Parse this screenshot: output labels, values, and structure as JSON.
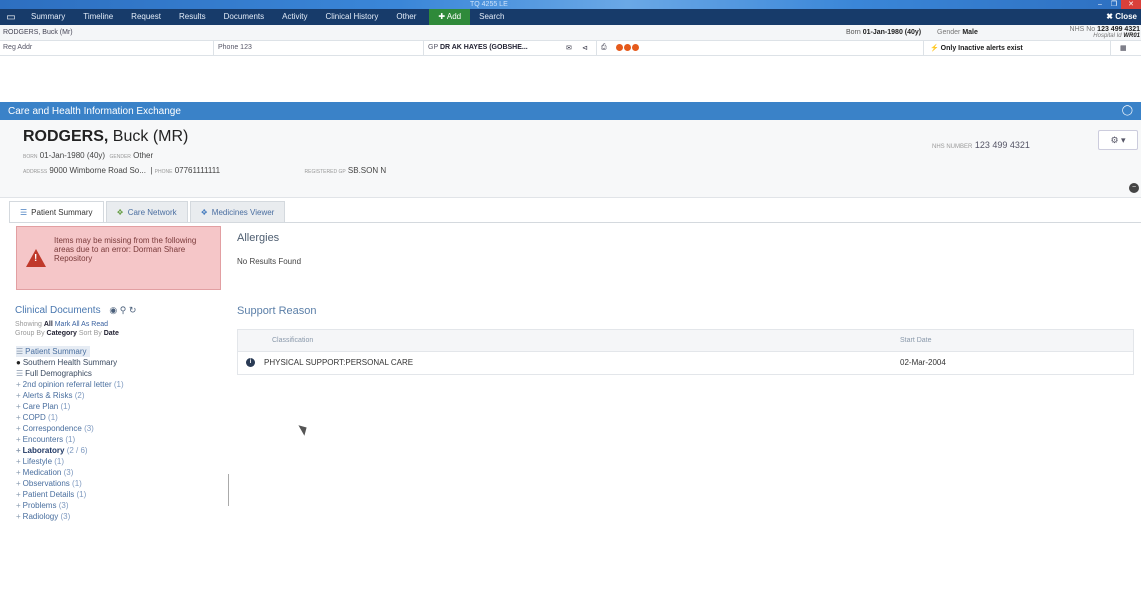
{
  "window": {
    "title": "TQ 4255 LE",
    "controls": [
      "–",
      "❐",
      "✕"
    ]
  },
  "navbar": {
    "home_icon": "monitor-icon",
    "items": [
      "Summary",
      "Timeline",
      "Request",
      "Results",
      "Documents",
      "Activity",
      "Clinical History",
      "Other"
    ],
    "add_label": "✚ Add",
    "search_label": "Search",
    "close_label": "✖ Close"
  },
  "banner": {
    "patient_name": "RODGERS, Buck (Mr)",
    "born_label": "Born",
    "born_value": "01-Jan-1980 (40y)",
    "gender_label": "Gender",
    "gender_value": "Male",
    "nhs_label": "NHS No",
    "nhs_value": "123 499 4321",
    "hospital_label": "Hospital Id",
    "hospital_value": "WR01",
    "reg": "Reg Addr",
    "phone": "Phone 123",
    "gp_label": "GP",
    "gp_value": "DR AK HAYES (GOBSHE...",
    "alerts": "Only Inactive alerts exist",
    "colors": {
      "accent": "#3a82c8",
      "navbar": "#173b6a",
      "add": "#2f8a3a",
      "warning_bg": "#f5c6c8"
    }
  },
  "che": {
    "title": "Care and Health Information Exchange"
  },
  "patient": {
    "surname": "RODGERS,",
    "forename": "Buck (MR)",
    "born_label": "BORN",
    "born_value": "01-Jan-1980 (40y)",
    "gender_label": "GENDER",
    "gender_value": "Other",
    "address_label": "ADDRESS",
    "address_value": "9000 Wimborne Road So...",
    "phone_label": "PHONE",
    "phone_value": "07761111111",
    "postcode_label": "REGISTERED GP",
    "postcode_value": "SB.SON N",
    "nhs_label": "NHS Number",
    "nhs_value": "123 499 4321"
  },
  "tabs": [
    {
      "label": "Patient Summary",
      "icon": "list-icon"
    },
    {
      "label": "Care Network",
      "icon": "network-icon"
    },
    {
      "label": "Medicines Viewer",
      "icon": "pill-icon"
    }
  ],
  "warning": {
    "text": "Items may be missing from the following areas due to an error: Dorman Share Repository"
  },
  "clinical_documents": {
    "title": "Clinical Documents",
    "show_label": "Showing",
    "show_all": "All",
    "mark_all": "Mark All As Read",
    "group_label": "Group By",
    "group_category": "Category",
    "sort_label": "Sort By",
    "sort_date": "Date"
  },
  "tree": [
    {
      "label": "Patient Summary",
      "count": "",
      "prefix": "☰",
      "style": "sel"
    },
    {
      "label": "Southern Health Summary",
      "count": "",
      "prefix": "●",
      "style": "top"
    },
    {
      "label": "Full Demographics",
      "count": "",
      "prefix": "☰",
      "style": "top"
    },
    {
      "label": "2nd opinion referral letter",
      "count": "(1)",
      "prefix": "+",
      "style": ""
    },
    {
      "label": "Alerts & Risks",
      "count": "(2)",
      "prefix": "+",
      "style": ""
    },
    {
      "label": "Care Plan",
      "count": "(1)",
      "prefix": "+",
      "style": ""
    },
    {
      "label": "COPD",
      "count": "(1)",
      "prefix": "+",
      "style": ""
    },
    {
      "label": "Correspondence",
      "count": "(3)",
      "prefix": "+",
      "style": ""
    },
    {
      "label": "Encounters",
      "count": "(1)",
      "prefix": "+",
      "style": ""
    },
    {
      "label": "Laboratory",
      "count": "(2 / 6)",
      "prefix": "+",
      "style": "bold"
    },
    {
      "label": "Lifestyle",
      "count": "(1)",
      "prefix": "+",
      "style": ""
    },
    {
      "label": "Medication",
      "count": "(3)",
      "prefix": "+",
      "style": ""
    },
    {
      "label": "Observations",
      "count": "(1)",
      "prefix": "+",
      "style": ""
    },
    {
      "label": "Patient Details",
      "count": "(1)",
      "prefix": "+",
      "style": ""
    },
    {
      "label": "Problems",
      "count": "(3)",
      "prefix": "+",
      "style": ""
    },
    {
      "label": "Radiology",
      "count": "(3)",
      "prefix": "+",
      "style": ""
    }
  ],
  "allergies": {
    "title": "Allergies",
    "value": "No Results Found"
  },
  "support_reason": {
    "title": "Support Reason",
    "columns": [
      "Classification",
      "Start Date"
    ],
    "rows": [
      {
        "classification": "PHYSICAL SUPPORT:PERSONAL CARE",
        "start_date": "02-Mar-2004"
      }
    ]
  }
}
